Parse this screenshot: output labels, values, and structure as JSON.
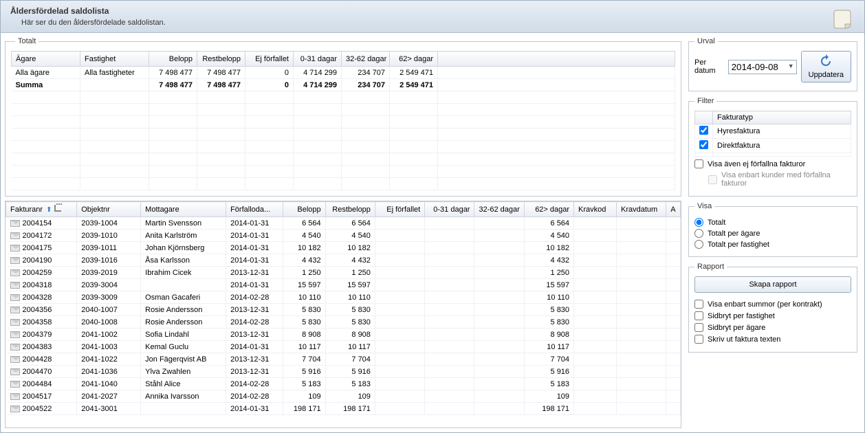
{
  "header": {
    "title": "Åldersfördelad saldolista",
    "subtitle": "Här ser du den åldersfördelade saldolistan."
  },
  "totalGrid": {
    "legend": "Totalt",
    "columns": [
      "Ägare",
      "Fastighet",
      "Belopp",
      "Restbelopp",
      "Ej förfallet",
      "0-31 dagar",
      "32-62 dagar",
      "62> dagar"
    ],
    "rows": [
      {
        "agare": "Alla ägare",
        "fastighet": "Alla fastigheter",
        "belopp": "7 498 477",
        "rest": "7 498 477",
        "ej": "0",
        "d031": "4 714 299",
        "d3262": "234 707",
        "d62": "2 549 471",
        "sum": false
      },
      {
        "agare": "Summa",
        "fastighet": "",
        "belopp": "7 498 477",
        "rest": "7 498 477",
        "ej": "0",
        "d031": "4 714 299",
        "d3262": "234 707",
        "d62": "2 549 471",
        "sum": true
      }
    ]
  },
  "detailGrid": {
    "columns": [
      "Fakturanr",
      "Objektnr",
      "Mottagare",
      "Förfalloda...",
      "Belopp",
      "Restbelopp",
      "Ej förfallet",
      "0-31 dagar",
      "32-62 dagar",
      "62> dagar",
      "Kravkod",
      "Kravdatum",
      "A"
    ],
    "rows": [
      {
        "fnr": "2004154",
        "obj": "2039-1004",
        "mott": "Martin Svensson",
        "forf": "2014-01-31",
        "belopp": "6 564",
        "rest": "6 564",
        "ej": "",
        "d031": "",
        "d3262": "",
        "d62": "6 564",
        "krav": "",
        "kdat": ""
      },
      {
        "fnr": "2004172",
        "obj": "2039-1010",
        "mott": "Anita Karlström",
        "forf": "2014-01-31",
        "belopp": "4 540",
        "rest": "4 540",
        "ej": "",
        "d031": "",
        "d3262": "",
        "d62": "4 540",
        "krav": "",
        "kdat": ""
      },
      {
        "fnr": "2004175",
        "obj": "2039-1011",
        "mott": "Johan Kjörnsberg",
        "forf": "2014-01-31",
        "belopp": "10 182",
        "rest": "10 182",
        "ej": "",
        "d031": "",
        "d3262": "",
        "d62": "10 182",
        "krav": "",
        "kdat": ""
      },
      {
        "fnr": "2004190",
        "obj": "2039-1016",
        "mott": "Åsa Karlsson",
        "forf": "2014-01-31",
        "belopp": "4 432",
        "rest": "4 432",
        "ej": "",
        "d031": "",
        "d3262": "",
        "d62": "4 432",
        "krav": "",
        "kdat": ""
      },
      {
        "fnr": "2004259",
        "obj": "2039-2019",
        "mott": "Ibrahim Cicek",
        "forf": "2013-12-31",
        "belopp": "1 250",
        "rest": "1 250",
        "ej": "",
        "d031": "",
        "d3262": "",
        "d62": "1 250",
        "krav": "",
        "kdat": ""
      },
      {
        "fnr": "2004318",
        "obj": "2039-3004",
        "mott": "",
        "forf": "2014-01-31",
        "belopp": "15 597",
        "rest": "15 597",
        "ej": "",
        "d031": "",
        "d3262": "",
        "d62": "15 597",
        "krav": "",
        "kdat": ""
      },
      {
        "fnr": "2004328",
        "obj": "2039-3009",
        "mott": "Osman Gacaferi",
        "forf": "2014-02-28",
        "belopp": "10 110",
        "rest": "10 110",
        "ej": "",
        "d031": "",
        "d3262": "",
        "d62": "10 110",
        "krav": "",
        "kdat": ""
      },
      {
        "fnr": "2004356",
        "obj": "2040-1007",
        "mott": "Rosie Andersson",
        "forf": "2013-12-31",
        "belopp": "5 830",
        "rest": "5 830",
        "ej": "",
        "d031": "",
        "d3262": "",
        "d62": "5 830",
        "krav": "",
        "kdat": ""
      },
      {
        "fnr": "2004358",
        "obj": "2040-1008",
        "mott": "Rosie Andersson",
        "forf": "2014-02-28",
        "belopp": "5 830",
        "rest": "5 830",
        "ej": "",
        "d031": "",
        "d3262": "",
        "d62": "5 830",
        "krav": "",
        "kdat": ""
      },
      {
        "fnr": "2004379",
        "obj": "2041-1002",
        "mott": "Sofia Lindahl",
        "forf": "2013-12-31",
        "belopp": "8 908",
        "rest": "8 908",
        "ej": "",
        "d031": "",
        "d3262": "",
        "d62": "8 908",
        "krav": "",
        "kdat": ""
      },
      {
        "fnr": "2004383",
        "obj": "2041-1003",
        "mott": "Kemal Guclu",
        "forf": "2014-01-31",
        "belopp": "10 117",
        "rest": "10 117",
        "ej": "",
        "d031": "",
        "d3262": "",
        "d62": "10 117",
        "krav": "",
        "kdat": ""
      },
      {
        "fnr": "2004428",
        "obj": "2041-1022",
        "mott": "Jon Fägerqvist AB",
        "forf": "2013-12-31",
        "belopp": "7 704",
        "rest": "7 704",
        "ej": "",
        "d031": "",
        "d3262": "",
        "d62": "7 704",
        "krav": "",
        "kdat": ""
      },
      {
        "fnr": "2004470",
        "obj": "2041-1036",
        "mott": "Ylva Zwahlen",
        "forf": "2013-12-31",
        "belopp": "5 916",
        "rest": "5 916",
        "ej": "",
        "d031": "",
        "d3262": "",
        "d62": "5 916",
        "krav": "",
        "kdat": ""
      },
      {
        "fnr": "2004484",
        "obj": "2041-1040",
        "mott": "Ståhl Alice",
        "forf": "2014-02-28",
        "belopp": "5 183",
        "rest": "5 183",
        "ej": "",
        "d031": "",
        "d3262": "",
        "d62": "5 183",
        "krav": "",
        "kdat": ""
      },
      {
        "fnr": "2004517",
        "obj": "2041-2027",
        "mott": "Annika Ivarsson",
        "forf": "2014-02-28",
        "belopp": "109",
        "rest": "109",
        "ej": "",
        "d031": "",
        "d3262": "",
        "d62": "109",
        "krav": "",
        "kdat": ""
      },
      {
        "fnr": "2004522",
        "obj": "2041-3001",
        "mott": "",
        "forf": "2014-01-31",
        "belopp": "198 171",
        "rest": "198 171",
        "ej": "",
        "d031": "",
        "d3262": "",
        "d62": "198 171",
        "krav": "",
        "kdat": ""
      }
    ]
  },
  "urval": {
    "legend": "Urval",
    "perDatumLabel": "Per datum",
    "perDatumValue": "2014-09-08",
    "uppdateraLabel": "Uppdatera"
  },
  "filter": {
    "legend": "Filter",
    "columnHeader": "Fakturatyp",
    "items": [
      {
        "label": "Hyresfaktura",
        "checked": true
      },
      {
        "label": "Direktfaktura",
        "checked": true
      }
    ],
    "visaEj": "Visa även ej förfallna fakturor",
    "visaEnbart": "Visa enbart kunder med förfallna fakturor"
  },
  "visa": {
    "legend": "Visa",
    "options": [
      "Totalt",
      "Totalt per ägare",
      "Totalt per fastighet"
    ],
    "selected": 0
  },
  "rapport": {
    "legend": "Rapport",
    "button": "Skapa rapport",
    "checks": [
      "Visa enbart summor (per kontrakt)",
      "Sidbryt per fastighet",
      "Sidbryt per ägare",
      "Skriv ut faktura texten"
    ]
  }
}
